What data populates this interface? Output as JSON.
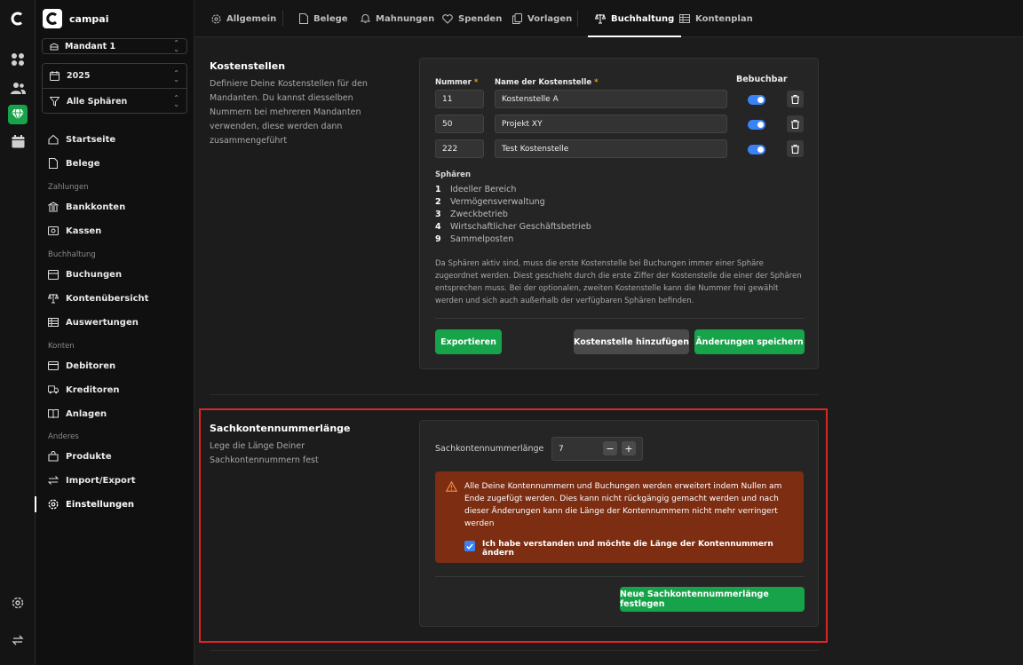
{
  "rail": {
    "items": [
      "logo-icon",
      "grid-icon",
      "users-icon",
      "gem-icon",
      "calendar-icon"
    ],
    "bottom": [
      "settings-icon",
      "switch-icon"
    ],
    "accent": "#16a34a"
  },
  "brand": {
    "name": "campai"
  },
  "mandant": {
    "label": "Mandant 1"
  },
  "year": {
    "label": "2025"
  },
  "sphere": {
    "label": "Alle Sphären"
  },
  "nav": {
    "startseite": "Startseite",
    "belege": "Belege",
    "sec_zahlungen": "Zahlungen",
    "bankkonten": "Bankkonten",
    "kassen": "Kassen",
    "sec_buchhaltung": "Buchhaltung",
    "buchungen": "Buchungen",
    "kontenuebersicht": "Kontenübersicht",
    "auswertungen": "Auswertungen",
    "sec_konten": "Konten",
    "debitoren": "Debitoren",
    "kreditoren": "Kreditoren",
    "anlagen": "Anlagen",
    "sec_anderes": "Anderes",
    "produkte": "Produkte",
    "import_export": "Import/Export",
    "einstellungen": "Einstellungen"
  },
  "tabs": [
    "Allgemein",
    "Belege",
    "Mahnungen",
    "Spenden",
    "Vorlagen",
    "Buchhaltung",
    "Kontenplan"
  ],
  "kostenstellen": {
    "title": "Kostenstellen",
    "description": "Definiere Deine Kostenstellen für den Mandanten. Du kannst diesselben Nummern bei mehreren Mandanten verwenden, diese werden dann zusammengeführt",
    "col_nummer": "Nummer",
    "col_name": "Name der Kostenstelle",
    "col_bebuchbar": "Bebuchbar",
    "required_mark": "*",
    "rows": [
      {
        "nummer": "11",
        "name": "Kostenstelle A"
      },
      {
        "nummer": "50",
        "name": "Projekt XY"
      },
      {
        "nummer": "222",
        "name": "Test Kostenstelle"
      }
    ],
    "spheres_title": "Sphären",
    "spheres": [
      {
        "n": "1",
        "label": "Ideeller Bereich"
      },
      {
        "n": "2",
        "label": "Vermögensverwaltung"
      },
      {
        "n": "3",
        "label": "Zweckbetrieb"
      },
      {
        "n": "4",
        "label": "Wirtschaftlicher Geschäftsbetrieb"
      },
      {
        "n": "9",
        "label": "Sammelposten"
      }
    ],
    "note": "Da Sphären aktiv sind, muss die erste Kostenstelle bei Buchungen immer einer Sphäre zugeordnet werden. Diest geschieht durch die erste Ziffer der Kostenstelle die einer der Sphären entsprechen muss. Bei der optionalen, zweiten Kostenstelle kann die Nummer frei gewählt werden und sich auch außerhalb der verfügbaren Sphären befinden.",
    "export_label": "Exportieren",
    "add_label": "Kostenstelle hinzufügen",
    "save_label": "Änderungen speichern"
  },
  "sachkonten": {
    "title": "Sachkontennummerlänge",
    "description": "Lege die Länge Deiner Sachkontennummern fest",
    "field_label": "Sachkontennummerlänge",
    "value": "7",
    "minus": "−",
    "plus": "+",
    "warning": "Alle Deine Kontennummern und Buchungen werden erweitert indem Nullen am Ende zugefügt werden. Dies kann nicht rückgängig gemacht werden und nach dieser Änderungen kann die Länge der Kontennummern nicht mehr verringert werden",
    "confirm_label": "Ich habe verstanden und möchte die Länge der Kontennummern ändern",
    "confirm_checked": true,
    "submit_label": "Neue Sachkontennummerlänge festlegen"
  },
  "colors": {
    "green": "#16a34a",
    "blue": "#3b82f6",
    "warning_bg": "#7c2d12",
    "highlight": "#dc2626"
  }
}
